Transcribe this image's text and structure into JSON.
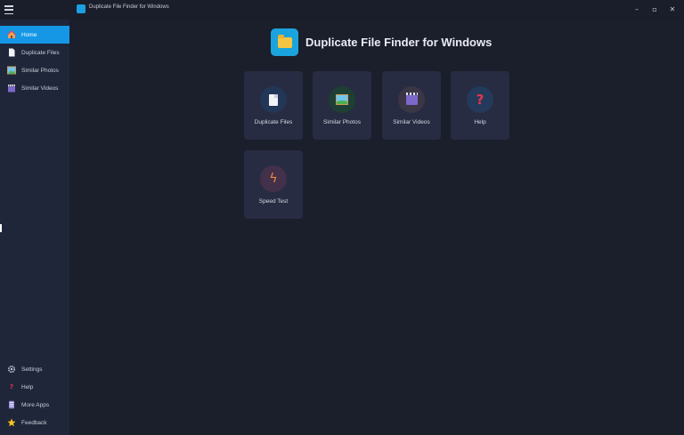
{
  "window": {
    "title": "Duplicate File Finder for Windows",
    "controls": {
      "minimize": "–",
      "maximize": "▫",
      "close": "✕"
    }
  },
  "sidebar": {
    "top_items": [
      {
        "label": "Home",
        "icon": "home-icon",
        "active": true
      },
      {
        "label": "Duplicate Files",
        "icon": "document-icon",
        "active": false
      },
      {
        "label": "Similar Photos",
        "icon": "photo-icon",
        "active": false
      },
      {
        "label": "Similar Videos",
        "icon": "video-icon",
        "active": false
      }
    ],
    "bottom_items": [
      {
        "label": "Settings",
        "icon": "gear-icon"
      },
      {
        "label": "Help",
        "icon": "question-icon"
      },
      {
        "label": "More Apps",
        "icon": "apps-icon"
      },
      {
        "label": "Feedback",
        "icon": "star-icon"
      }
    ]
  },
  "main": {
    "title": "Duplicate File Finder for Windows",
    "tiles": [
      {
        "label": "Duplicate Files",
        "icon": "document-icon"
      },
      {
        "label": "Similar Photos",
        "icon": "photo-icon"
      },
      {
        "label": "Similar Videos",
        "icon": "video-icon"
      },
      {
        "label": "Help",
        "icon": "question-icon"
      },
      {
        "label": "Speed Test",
        "icon": "lightning-icon"
      }
    ]
  },
  "colors": {
    "accent": "#1597e5",
    "sidebar_bg": "#20263a",
    "main_bg": "#1b1e2b",
    "tile_bg": "#272c42"
  }
}
